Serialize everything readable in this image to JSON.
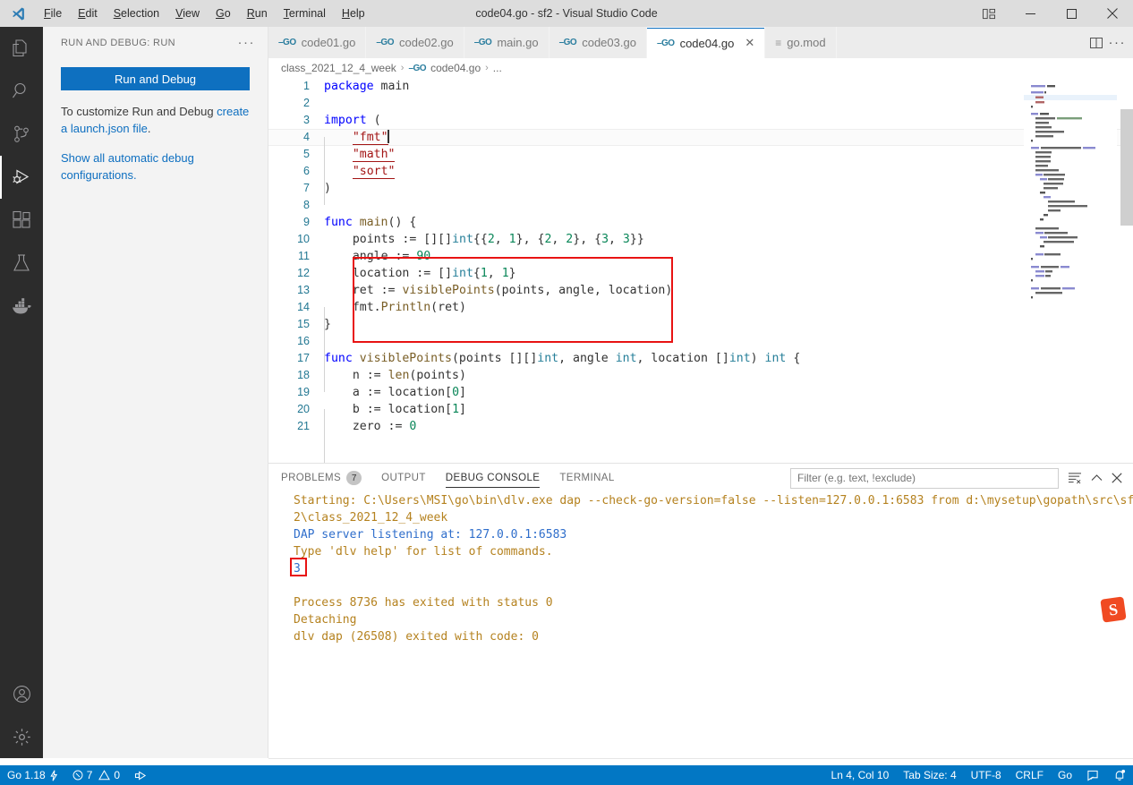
{
  "window": {
    "title": "code04.go - sf2 - Visual Studio Code",
    "menus": [
      "File",
      "Edit",
      "Selection",
      "View",
      "Go",
      "Run",
      "Terminal",
      "Help"
    ],
    "controls": {
      "layout": "customize-layout",
      "minimize": "–",
      "maximize": "□",
      "close": "✕"
    }
  },
  "activitybar": {
    "items": [
      {
        "name": "explorer",
        "label": "Explorer"
      },
      {
        "name": "search",
        "label": "Search"
      },
      {
        "name": "source-control",
        "label": "Source Control"
      },
      {
        "name": "run-and-debug",
        "label": "Run and Debug",
        "active": true
      },
      {
        "name": "extensions",
        "label": "Extensions"
      },
      {
        "name": "testing",
        "label": "Testing"
      },
      {
        "name": "docker",
        "label": "Docker"
      }
    ],
    "bottom": [
      {
        "name": "accounts",
        "label": "Accounts"
      },
      {
        "name": "settings",
        "label": "Manage"
      }
    ]
  },
  "sidebar": {
    "title": "RUN AND DEBUG: RUN",
    "more": "···",
    "run_button": "Run and Debug",
    "hint_prefix": "To customize Run and Debug ",
    "hint_link": "create a launch.json file",
    "hint_suffix": ".",
    "automatic_link": "Show all automatic debug configurations."
  },
  "tabs": [
    {
      "label": "code01.go",
      "icon": "go-file-icon",
      "active": false
    },
    {
      "label": "code02.go",
      "icon": "go-file-icon",
      "active": false
    },
    {
      "label": "main.go",
      "icon": "go-file-icon",
      "active": false
    },
    {
      "label": "code03.go",
      "icon": "go-file-icon",
      "active": false
    },
    {
      "label": "code04.go",
      "icon": "go-file-icon",
      "active": true,
      "close": "✕"
    },
    {
      "label": "go.mod",
      "icon": "text-file-icon",
      "active": false
    }
  ],
  "tab_actions": {
    "split": "split-editor-right",
    "more": "···"
  },
  "breadcrumb": {
    "items": [
      "class_2021_12_4_week",
      "code04.go",
      "..."
    ],
    "separator": "›"
  },
  "editor": {
    "cursor_line": 4,
    "lines": [
      {
        "n": 1,
        "text": "package main"
      },
      {
        "n": 2,
        "text": ""
      },
      {
        "n": 3,
        "text": "import ("
      },
      {
        "n": 4,
        "text": "    \"fmt\""
      },
      {
        "n": 5,
        "text": "    \"math\""
      },
      {
        "n": 6,
        "text": "    \"sort\""
      },
      {
        "n": 7,
        "text": ")"
      },
      {
        "n": 8,
        "text": ""
      },
      {
        "n": 9,
        "text": "func main() {"
      },
      {
        "n": 10,
        "text": "    points := [][]int{{2, 1}, {2, 2}, {3, 3}}"
      },
      {
        "n": 11,
        "text": "    angle := 90"
      },
      {
        "n": 12,
        "text": "    location := []int{1, 1}"
      },
      {
        "n": 13,
        "text": "    ret := visiblePoints(points, angle, location)"
      },
      {
        "n": 14,
        "text": "    fmt.Println(ret)"
      },
      {
        "n": 15,
        "text": "}"
      },
      {
        "n": 16,
        "text": ""
      },
      {
        "n": 17,
        "text": "func visiblePoints(points [][]int, angle int, location []int) int {"
      },
      {
        "n": 18,
        "text": "    n := len(points)"
      },
      {
        "n": 19,
        "text": "    a := location[0]"
      },
      {
        "n": 20,
        "text": "    b := location[1]"
      },
      {
        "n": 21,
        "text": "    zero := 0"
      }
    ]
  },
  "panel": {
    "tabs": [
      {
        "label": "PROBLEMS",
        "badge": "7",
        "active": false
      },
      {
        "label": "OUTPUT",
        "badge": null,
        "active": false
      },
      {
        "label": "DEBUG CONSOLE",
        "badge": null,
        "active": true
      },
      {
        "label": "TERMINAL",
        "badge": null,
        "active": false
      }
    ],
    "filter_placeholder": "Filter (e.g. text, !exclude)",
    "filter_value": "",
    "actions": [
      "clear-console-icon",
      "collapse-icon",
      "close-panel-icon"
    ],
    "console_lines": [
      {
        "text": "Starting: C:\\Users\\MSI\\go\\bin\\dlv.exe dap --check-go-version=false --listen=127.0.0.1:6583 from d:\\mysetup\\gopath\\src\\sf",
        "kind": "info"
      },
      {
        "text": "2\\class_2021_12_4_week",
        "kind": "info"
      },
      {
        "text": "DAP server listening at: 127.0.0.1:6583",
        "kind": "blue"
      },
      {
        "text": "Type 'dlv help' for list of commands.",
        "kind": "info"
      },
      {
        "text": "3",
        "kind": "blue",
        "highlighted": true
      },
      {
        "text": "",
        "kind": "info"
      },
      {
        "text": "Process 8736 has exited with status 0",
        "kind": "info"
      },
      {
        "text": "Detaching",
        "kind": "info"
      },
      {
        "text": "dlv dap (26508) exited with code: 0",
        "kind": "info"
      }
    ],
    "prompt": "›"
  },
  "statusbar": {
    "left": [
      {
        "name": "go-version",
        "label": "Go 1.18",
        "icon": "lightning-icon"
      },
      {
        "name": "problems",
        "label": "7",
        "label2": "0",
        "icon": "error-icon",
        "icon2": "warning-icon"
      },
      {
        "name": "go-debug",
        "label": "",
        "icon": "debug-alt-icon"
      }
    ],
    "right": [
      {
        "name": "cursor-position",
        "label": "Ln 4, Col 10"
      },
      {
        "name": "tab-size",
        "label": "Tab Size: 4"
      },
      {
        "name": "encoding",
        "label": "UTF-8"
      },
      {
        "name": "eol",
        "label": "CRLF"
      },
      {
        "name": "language-mode",
        "label": "Go"
      },
      {
        "name": "feedback",
        "label": "",
        "icon": "feedback-icon"
      },
      {
        "name": "notifications",
        "label": "",
        "icon": "bell-dot-icon"
      }
    ]
  },
  "watermark": {
    "label": "S"
  },
  "colors": {
    "accent": "#0277c4",
    "button": "#0e70c0",
    "link": "#0e6fc0",
    "redbox": "#e81313",
    "titlebar": "#dddddd",
    "activitybar": "#2c2c2c",
    "sidebar": "#f3f3f3"
  }
}
